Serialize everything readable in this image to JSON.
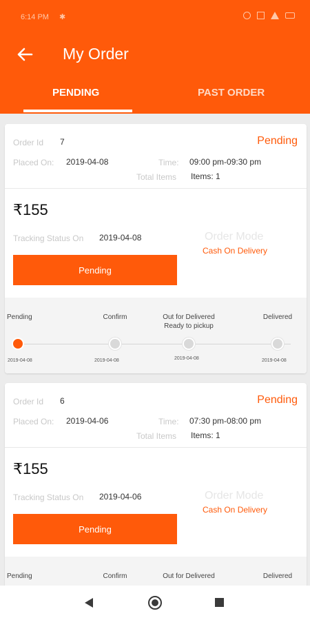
{
  "status_bar": {
    "time": "6:14 PM",
    "icons": [
      "bluetooth-icon",
      "alarm-icon",
      "signal-icon",
      "wifi-icon",
      "battery-icon"
    ]
  },
  "header": {
    "title": "My Order",
    "back_icon": "arrow-left-icon"
  },
  "tabs": [
    {
      "label": "PENDING",
      "selected": true
    },
    {
      "label": "PAST ORDER",
      "selected": false
    }
  ],
  "labels": {
    "order_id": "Order Id",
    "placed_on": "Placed On:",
    "time": "Time:",
    "total_items": "Total Items",
    "tracking_status_on": "Tracking Status On",
    "order_mode": "Order Mode"
  },
  "orders": [
    {
      "id": "7",
      "status": "Pending",
      "placed_on": "2019-04-08",
      "time": "09:00 pm-09:30 pm",
      "items": "Items: 1",
      "price": "₹155",
      "tracking_date": "2019-04-08",
      "order_mode": "Cash On Delivery",
      "button_label": "Pending",
      "steps": [
        {
          "label": "Pending",
          "date": "2019-04-08",
          "active": true
        },
        {
          "label": "Confirm",
          "date": "2019-04-08",
          "active": false
        },
        {
          "label": "Out for Delivered\nReady to pickup",
          "date": "2019-04-08",
          "active": false
        },
        {
          "label": "Delivered",
          "date": "2019-04-08",
          "active": false
        }
      ]
    },
    {
      "id": "6",
      "status": "Pending",
      "placed_on": "2019-04-06",
      "time": "07:30 pm-08:00 pm",
      "items": "Items: 1",
      "price": "₹155",
      "tracking_date": "2019-04-06",
      "order_mode": "Cash On Delivery",
      "button_label": "Pending",
      "steps": [
        {
          "label": "Pending",
          "date": "",
          "active": true
        },
        {
          "label": "Confirm",
          "date": "",
          "active": false
        },
        {
          "label": "Out for Delivered",
          "date": "",
          "active": false
        },
        {
          "label": "Delivered",
          "date": "",
          "active": false
        }
      ]
    }
  ],
  "colors": {
    "accent": "#ff5a0a",
    "background": "#ececec",
    "tracker_bg": "#f4f4f4"
  },
  "nav_bar": {
    "icons": [
      "back-triangle-icon",
      "home-circle-icon",
      "recents-square-icon"
    ]
  }
}
